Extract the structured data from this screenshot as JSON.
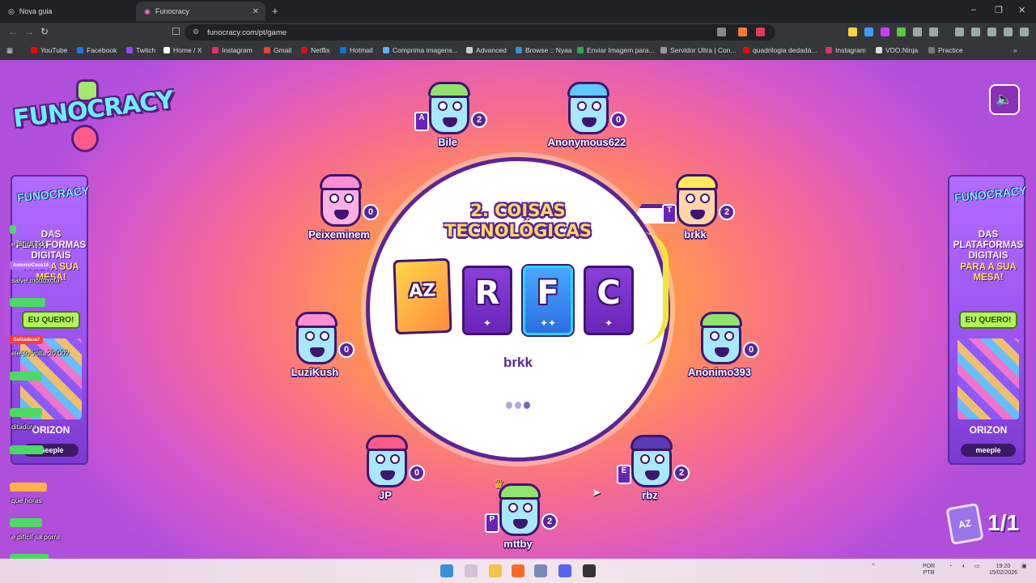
{
  "browser": {
    "tabs": [
      {
        "label": "Nova guia"
      },
      {
        "label": "Funocracy"
      }
    ],
    "new_tab": "+",
    "window": {
      "minimize": "–",
      "maximize": "❐",
      "close": "✕"
    },
    "url": "funocracy.com/pt/game",
    "bookmarks": [
      {
        "label": "YouTube",
        "color": "#ff0000"
      },
      {
        "label": "Facebook",
        "color": "#1877f2"
      },
      {
        "label": "Twitch",
        "color": "#9146ff"
      },
      {
        "label": "Home / X",
        "color": "#ffffff"
      },
      {
        "label": "Instagram",
        "color": "#e1306c"
      },
      {
        "label": "Gmail",
        "color": "#ea4335"
      },
      {
        "label": "Netflix",
        "color": "#e50914"
      },
      {
        "label": "Hotmail",
        "color": "#0078d4"
      },
      {
        "label": "Comprima imagens...",
        "color": "#5ab0ff"
      },
      {
        "label": "Advanced",
        "color": "#cccccc"
      },
      {
        "label": "Browse :: Nyaa",
        "color": "#3a8fd6"
      },
      {
        "label": "Enviar Imagem para...",
        "color": "#2aa84a"
      },
      {
        "label": "Servidor Ultra | Con...",
        "color": "#999999"
      },
      {
        "label": "quadrilogia dedadá...",
        "color": "#ff0000"
      },
      {
        "label": "Instagram",
        "color": "#e1306c"
      },
      {
        "label": "VDO.Ninja",
        "color": "#dddddd"
      },
      {
        "label": "Practice",
        "color": "#777777"
      }
    ]
  },
  "game": {
    "logo": "FUNOCRACY",
    "round_title": "2. COISAS TECNOLÓGICAS",
    "az_card": "AZ",
    "cards": [
      {
        "letter": "R",
        "stars": "✦"
      },
      {
        "letter": "F",
        "stars": "✦✦"
      },
      {
        "letter": "C",
        "stars": "✦"
      }
    ],
    "current_player": "brkk",
    "round_counter": "1/1",
    "players": [
      {
        "name": "Bile",
        "score": "2",
        "letter": "A",
        "skin": "#a8e8ff",
        "hair": "#8fe26b"
      },
      {
        "name": "Anonymous622",
        "score": "0",
        "letter": "",
        "skin": "#a8e8ff",
        "hair": "#5fc9ff"
      },
      {
        "name": "Peixeminem",
        "score": "0",
        "letter": "",
        "skin": "#ffb0e0",
        "hair": "#ff8fd0"
      },
      {
        "name": "brkk",
        "score": "2",
        "letter": "T",
        "skin": "#ffd6a8",
        "hair": "#ffe95a"
      },
      {
        "name": "LuziKush",
        "score": "0",
        "letter": "",
        "skin": "#a8e8ff",
        "hair": "#ff8fd0"
      },
      {
        "name": "Anônimo393",
        "score": "0",
        "letter": "",
        "skin": "#a8e8ff",
        "hair": "#8fe26b"
      },
      {
        "name": "JP",
        "score": "0",
        "letter": "",
        "skin": "#a8e8ff",
        "hair": "#ff5c8a"
      },
      {
        "name": "rbz",
        "score": "2",
        "letter": "E",
        "skin": "#a8e8ff",
        "hair": "#5a3ab8"
      },
      {
        "name": "mttby",
        "score": "2",
        "letter": "P",
        "skin": "#a8e8ff",
        "hair": "#8fe26b"
      }
    ]
  },
  "banner": {
    "logo": "FUNOCRACY",
    "line1": "DAS",
    "line2": "PLATAFORMAS",
    "line3": "DIGITAIS",
    "line4": "PARA A SUA",
    "line5": "MESA!",
    "button": "EU QUERO!",
    "partner1": "ORIZON",
    "partner2": "meeple"
  },
  "chat": [
    {
      "user": "",
      "msg": "e difícil kkk",
      "color": "#4cd964"
    },
    {
      "user": "AntonioCaus14",
      "msg": "salve mottoxota",
      "color": "#b36bff"
    },
    {
      "user": "",
      "msg": "",
      "color": "#4cd964"
    },
    {
      "user": "",
      "msg": "",
      "color": "#4cd964"
    },
    {
      "user": "",
      "msg": "EU QUERO!",
      "color": "#4cd964"
    },
    {
      "user": "Gulzadaaa7",
      "msg": "ele so volta 20:00?",
      "color": "#ff3b3b"
    },
    {
      "user": "",
      "msg": "",
      "color": "#4cd964"
    },
    {
      "user": "",
      "msg": "ditadura",
      "color": "#4cd964"
    },
    {
      "user": "",
      "msg": "",
      "color": "#4cd964"
    },
    {
      "user": "",
      "msg": "que horas",
      "color": "#ffb347"
    },
    {
      "user": "",
      "msg": "e difícil sa porra",
      "color": "#4cd964"
    },
    {
      "user": "",
      "msg": "",
      "color": "#4cd964"
    }
  ],
  "taskbar": {
    "lang_top": "POR",
    "lang_bottom": "PTB",
    "time": "19:20",
    "date": "15/02/2026"
  }
}
